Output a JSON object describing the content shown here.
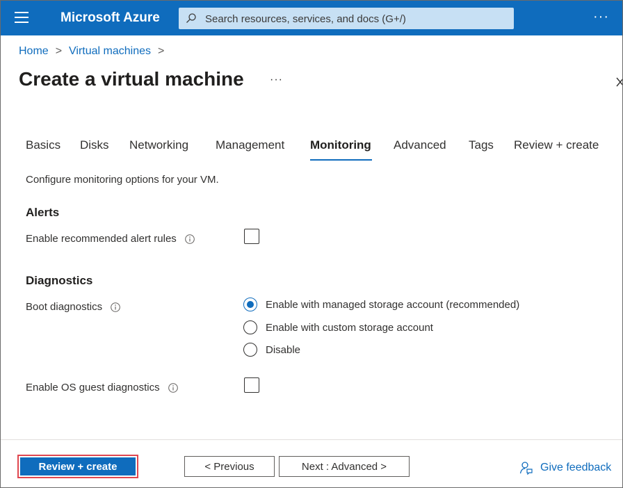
{
  "header": {
    "brand": "Microsoft Azure",
    "search_placeholder": "Search resources, services, and docs (G+/)",
    "more": "···"
  },
  "breadcrumb": {
    "home": "Home",
    "virtual_machines": "Virtual machines",
    "separator": ">"
  },
  "page": {
    "title": "Create a virtual machine",
    "more": "···"
  },
  "tabs": [
    {
      "label": "Basics"
    },
    {
      "label": "Disks"
    },
    {
      "label": "Networking"
    },
    {
      "label": "Management"
    },
    {
      "label": "Monitoring",
      "active": true
    },
    {
      "label": "Advanced"
    },
    {
      "label": "Tags"
    },
    {
      "label": "Review + create"
    }
  ],
  "content": {
    "description": "Configure monitoring options for your VM.",
    "alerts_heading": "Alerts",
    "alert_rules_label": "Enable recommended alert rules",
    "alert_rules_checked": false,
    "diagnostics_heading": "Diagnostics",
    "boot_diagnostics_label": "Boot diagnostics",
    "boot_options": [
      {
        "label": "Enable with managed storage account (recommended)",
        "selected": true
      },
      {
        "label": "Enable with custom storage account",
        "selected": false
      },
      {
        "label": "Disable",
        "selected": false
      }
    ],
    "os_guest_label": "Enable OS guest diagnostics",
    "os_guest_checked": false
  },
  "footer": {
    "review_create": "Review + create",
    "previous": "< Previous",
    "next": "Next : Advanced >",
    "feedback": "Give feedback"
  },
  "colors": {
    "accent": "#0f6cbd",
    "highlight_border": "#e0464f"
  }
}
